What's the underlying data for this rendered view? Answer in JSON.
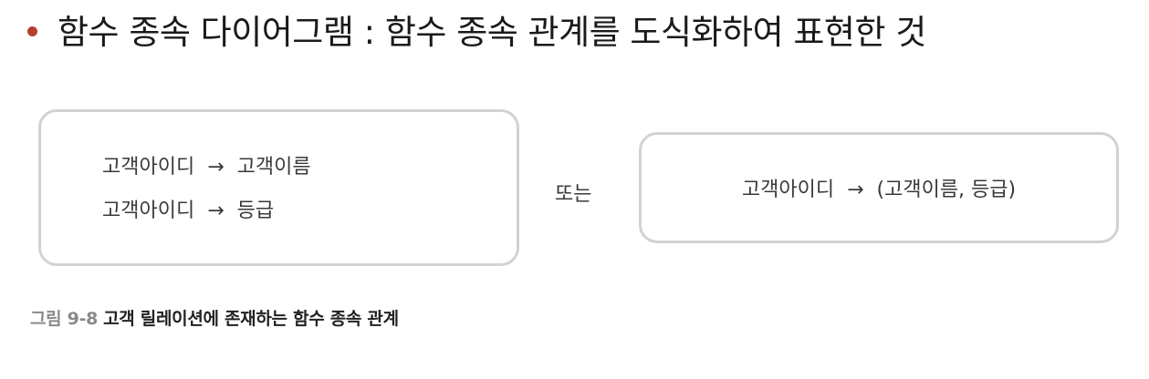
{
  "heading": {
    "text": "함수 종속 다이어그램 : 함수 종속 관계를 도식화하여 표현한 것"
  },
  "diagram": {
    "left_box": {
      "dependencies": [
        {
          "determinant": "고객아이디",
          "arrow": "→",
          "dependent": "고객이름"
        },
        {
          "determinant": "고객아이디",
          "arrow": "→",
          "dependent": "등급"
        }
      ]
    },
    "connector": "또는",
    "right_box": {
      "determinant": "고객아이디",
      "arrow": "→",
      "dependent": "(고객이름, 등급)"
    }
  },
  "caption": {
    "label": "그림 9-8",
    "text": "고객 릴레이션에 존재하는 함수 종속 관계"
  },
  "colors": {
    "bullet": "#b5402f",
    "box_border": "#d2d2d2",
    "caption_label": "#8a8a8a"
  }
}
